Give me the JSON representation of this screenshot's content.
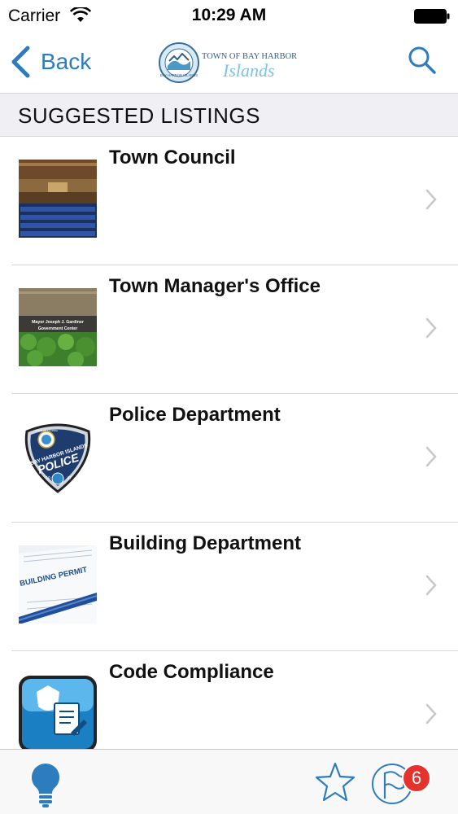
{
  "status_bar": {
    "carrier": "Carrier",
    "time": "10:29 AM"
  },
  "nav": {
    "back_label": "Back",
    "logo": {
      "line1": "TOWN OF BAY HARBOR",
      "line2": "Islands",
      "seal_text": "BAY HARBOR ISLANDS"
    }
  },
  "section": {
    "title": "SUGGESTED LISTINGS"
  },
  "listings": [
    {
      "title": "Town Council",
      "image": "council-chamber-photo"
    },
    {
      "title": "Town Manager's Office",
      "image": "government-center-photo",
      "sign_line1": "Mayor Joseph J. Gardiner",
      "sign_line2": "Government Center"
    },
    {
      "title": "Police Department",
      "image": "police-badge",
      "badge_top": "STATE OF FLORIDA",
      "badge_line1": "BAY HARBOR ISLANDS",
      "badge_line2": "POLICE",
      "badge_year1": "19",
      "badge_year2": "47"
    },
    {
      "title": "Building Department",
      "image": "building-permit-photo",
      "permit_text": "BUILDING PERMIT"
    },
    {
      "title": "Code Compliance",
      "image": "code-compliance-icon"
    }
  ],
  "tab_bar": {
    "notification_count": "6"
  },
  "colors": {
    "accent": "#2d7dbe",
    "badge": "#e5322d",
    "section_bg": "#efeff4"
  }
}
